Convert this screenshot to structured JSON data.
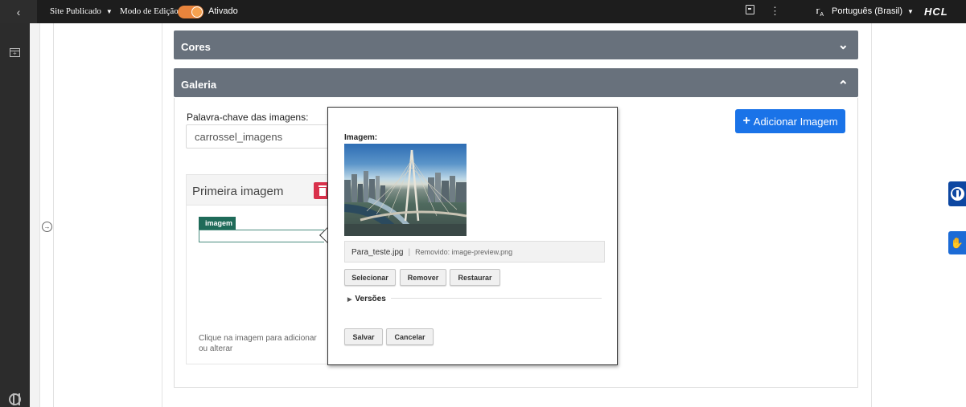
{
  "topbar": {
    "back_icon": "chevron-left-icon",
    "site_status": "Site Publicado",
    "edit_mode_label": "Modo de Edição:",
    "edit_mode_state": "Ativado",
    "language": "Português (Brasil)",
    "brand": "HCL"
  },
  "sections": {
    "colors_title": "Cores",
    "gallery_title": "Galeria"
  },
  "gallery": {
    "keyword_label": "Palavra-chave das imagens:",
    "keyword_value": "carrossel_imagens",
    "add_image_label": "Adicionar Imagem",
    "card_title": "Primeira imagem",
    "field_tag": "imagem",
    "hint": "Clique na imagem para adicionar ou alterar"
  },
  "popup": {
    "image_label": "Imagem:",
    "file_name": "Para_teste.jpg",
    "removed_text": "Removido: image-preview.png",
    "buttons": {
      "select": "Selecionar",
      "remove": "Remover",
      "restore": "Restaurar",
      "save": "Salvar",
      "cancel": "Cancelar"
    },
    "versions_label": "Versões"
  },
  "colors": {
    "accordion_header": "#68717c",
    "primary_button": "#1a73e8",
    "delete_button": "#d9314b",
    "field_tag": "#1f6b59",
    "toggle_on": "#e8843c"
  }
}
